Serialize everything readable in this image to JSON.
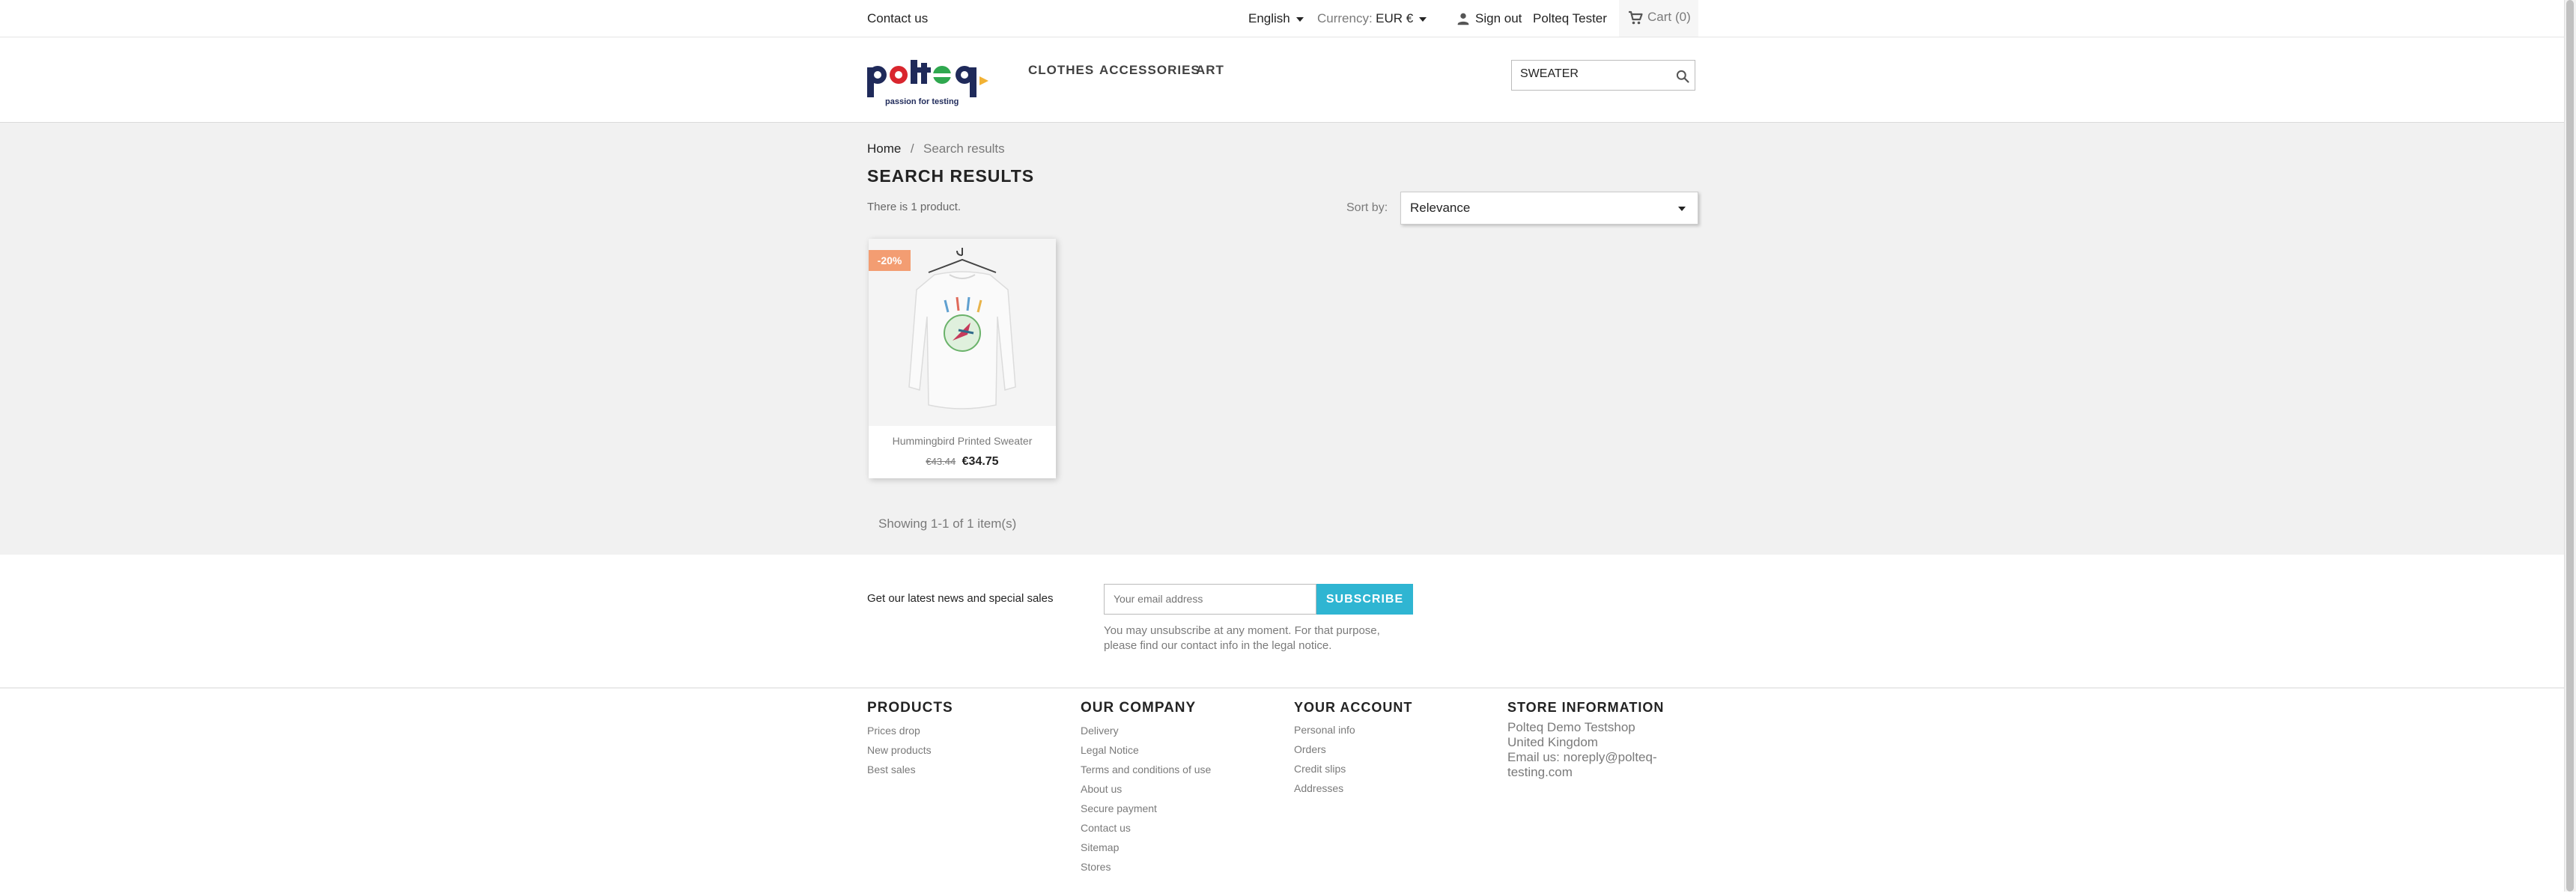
{
  "topbar": {
    "contact": "Contact us",
    "language": "English",
    "currency_label": "Currency:",
    "currency_value": "EUR €",
    "sign_out": "Sign out",
    "user_name": "Polteq Tester",
    "cart_label": "Cart",
    "cart_count": "(0)"
  },
  "header": {
    "logo_tagline": "passion for testing",
    "nav": [
      "CLOTHES",
      "ACCESSORIES",
      "ART"
    ],
    "search_value": "SWEATER"
  },
  "breadcrumb": {
    "home": "Home",
    "separator": "/",
    "current": "Search results"
  },
  "page": {
    "title": "SEARCH RESULTS",
    "count_text": "There is 1 product.",
    "sort_label": "Sort by:",
    "sort_value": "Relevance",
    "pagination_text": "Showing 1-1 of 1 item(s)"
  },
  "product": {
    "discount": "-20%",
    "name": "Hummingbird Printed Sweater",
    "old_price": "€43.44",
    "price": "€34.75"
  },
  "newsletter": {
    "label": "Get our latest news and special sales",
    "placeholder": "Your email address",
    "button": "SUBSCRIBE",
    "note_line1": "You may unsubscribe at any moment. For that purpose,",
    "note_line2": "please find our contact info in the legal notice."
  },
  "footer": {
    "products": {
      "title": "PRODUCTS",
      "links": [
        "Prices drop",
        "New products",
        "Best sales"
      ]
    },
    "company": {
      "title": "OUR COMPANY",
      "links": [
        "Delivery",
        "Legal Notice",
        "Terms and conditions of use",
        "About us",
        "Secure payment",
        "Contact us",
        "Sitemap",
        "Stores"
      ]
    },
    "account": {
      "title": "YOUR ACCOUNT",
      "links": [
        "Personal info",
        "Orders",
        "Credit slips",
        "Addresses"
      ]
    },
    "store": {
      "title": "STORE INFORMATION",
      "lines": [
        "Polteq Demo Testshop",
        "United Kingdom",
        "Email us: noreply@polteq-",
        "testing.com"
      ]
    }
  },
  "colors": {
    "accent": "#2fb5d2",
    "discount": "#f39d72",
    "content_bg": "#f1f1f1"
  },
  "icons": [
    "person-icon",
    "cart-icon",
    "search-icon",
    "caret-down-icon"
  ]
}
